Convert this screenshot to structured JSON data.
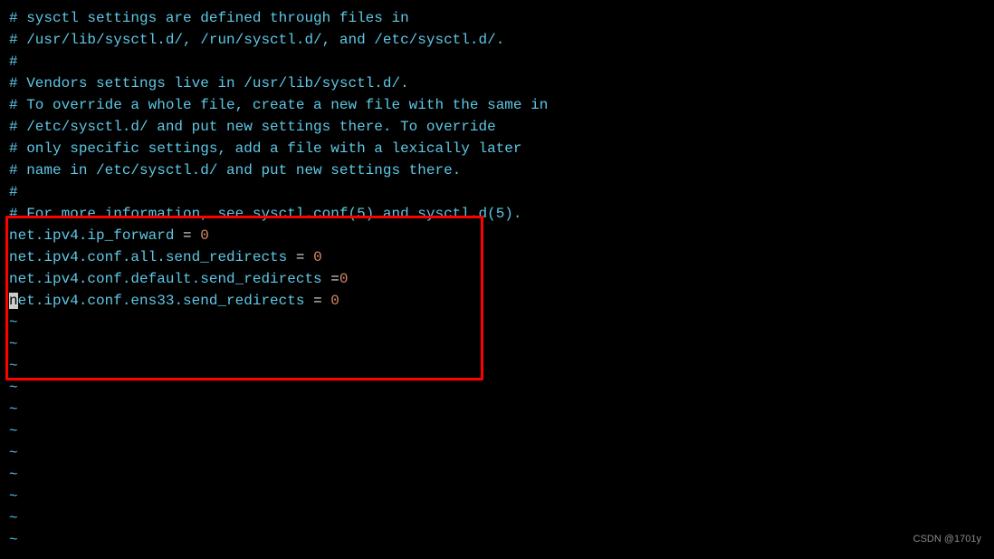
{
  "editor": {
    "comments": [
      "# sysctl settings are defined through files in",
      "# /usr/lib/sysctl.d/, /run/sysctl.d/, and /etc/sysctl.d/.",
      "#",
      "# Vendors settings live in /usr/lib/sysctl.d/.",
      "# To override a whole file, create a new file with the same in",
      "# /etc/sysctl.d/ and put new settings there. To override",
      "# only specific settings, add a file with a lexically later",
      "# name in /etc/sysctl.d/ and put new settings there.",
      "#",
      "# For more information, see sysctl.conf(5) and sysctl.d(5)."
    ],
    "settings": [
      {
        "key": "net.ipv4.ip_forward",
        "equals": " = ",
        "value": "0",
        "cursor": false
      },
      {
        "key": "net.ipv4.conf.all.send_redirects",
        "equals": " = ",
        "value": "0",
        "cursor": false
      },
      {
        "key": "net.ipv4.conf.default.send_redirects",
        "equals": " =",
        "value": "0",
        "cursor": false
      },
      {
        "key_prefix": "n",
        "key_rest": "et.ipv4.conf.ens33.send_redirects",
        "equals": " = ",
        "value": "0",
        "cursor": true
      }
    ],
    "tilde": "~",
    "tilde_count": 11
  },
  "watermark": "CSDN @1701y"
}
